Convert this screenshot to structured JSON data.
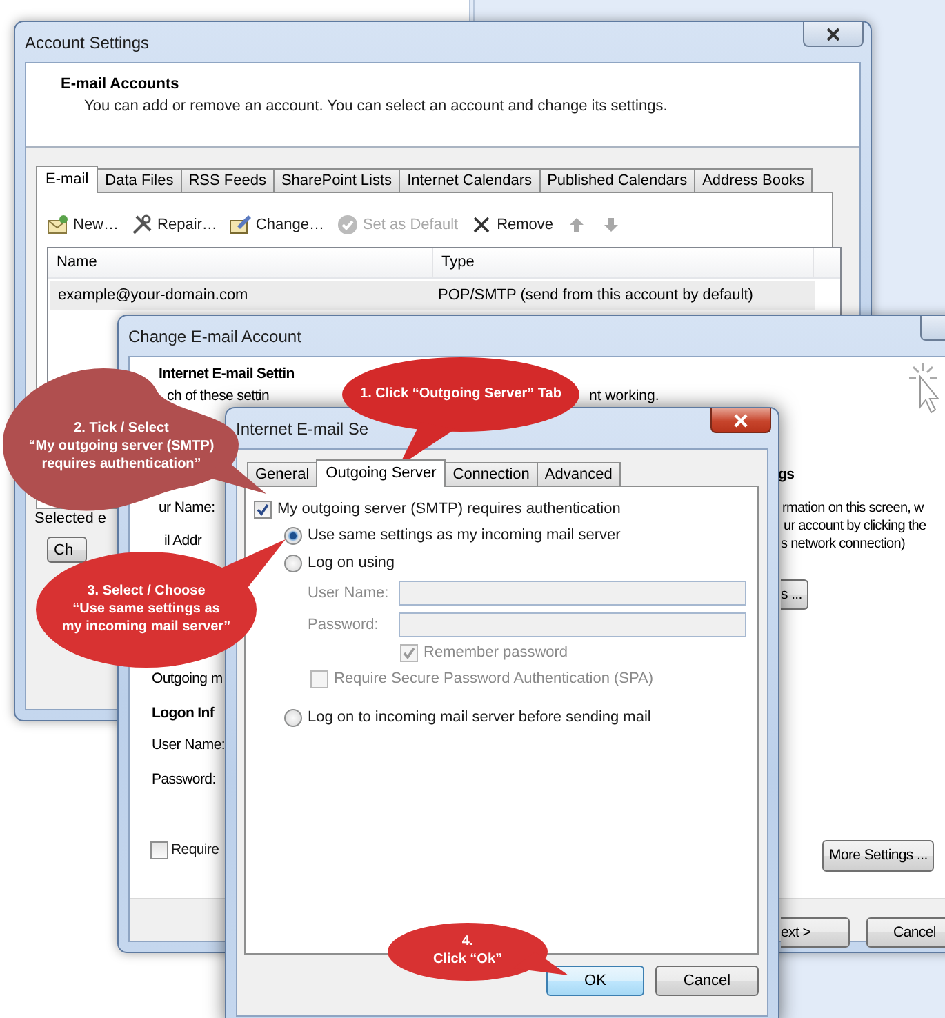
{
  "account_settings": {
    "title": "Account Settings",
    "heading": "E-mail Accounts",
    "subtitle": "You can add or remove an account. You can select an account and change its settings.",
    "tabs": [
      {
        "label": "E-mail",
        "selected": true
      },
      {
        "label": "Data Files",
        "selected": false
      },
      {
        "label": "RSS Feeds",
        "selected": false
      },
      {
        "label": "SharePoint Lists",
        "selected": false
      },
      {
        "label": "Internet Calendars",
        "selected": false
      },
      {
        "label": "Published Calendars",
        "selected": false
      },
      {
        "label": "Address Books",
        "selected": false
      }
    ],
    "toolbar": [
      {
        "kind": "new",
        "label": "New…",
        "disabled": false
      },
      {
        "kind": "repair",
        "label": "Repair…",
        "disabled": false
      },
      {
        "kind": "change",
        "label": "Change…",
        "disabled": false
      },
      {
        "kind": "default",
        "label": "Set as Default",
        "disabled": true
      },
      {
        "kind": "remove",
        "label": "Remove",
        "disabled": false
      },
      {
        "kind": "up",
        "disabled": true
      },
      {
        "kind": "down",
        "disabled": true
      }
    ],
    "table": {
      "columns": [
        "Name",
        "Type"
      ],
      "rows": [
        {
          "cells": [
            "example@your-domain.com",
            "POP/SMTP (send from this account by default)"
          ],
          "selected": true
        }
      ]
    },
    "selected_label": "Selected e",
    "change_button": "Ch"
  },
  "change_account": {
    "title": "Change E-mail Account",
    "heading": "Internet E-mail Settin",
    "intro_left": "ch of these settin",
    "intro_right": "nt working.",
    "left_labels": [
      "ur Name:",
      "il Addr",
      "Outgoing m"
    ],
    "logon_heading": "Logon Inf",
    "logon_labels": [
      "User Name:",
      "Password:"
    ],
    "require_checkbox": {
      "label": "Require",
      "checked": false
    },
    "right_heading": "gs",
    "right_lines": [
      "rmation on this screen, w",
      "ur account by clicking the",
      "s network connection)"
    ],
    "test_button": "s ...",
    "more_settings": "More Settings ...",
    "buttons": [
      "ext >",
      "Cancel"
    ]
  },
  "internet_settings": {
    "title": "Internet E-mail Se",
    "tabs": [
      {
        "label": "General",
        "selected": false
      },
      {
        "label": "Outgoing Server",
        "selected": true
      },
      {
        "label": "Connection",
        "selected": false
      },
      {
        "label": "Advanced",
        "selected": false
      }
    ],
    "auth_checkbox": {
      "label": "My outgoing server (SMTP) requires authentication",
      "checked": true
    },
    "options": [
      {
        "kind": "radio",
        "label": "Use same settings as my incoming mail server",
        "selected": true
      },
      {
        "kind": "radio",
        "label": "Log on using",
        "selected": false
      },
      {
        "kind": "field",
        "label": "User Name:",
        "disabled": true
      },
      {
        "kind": "field",
        "label": "Password:",
        "disabled": true
      },
      {
        "kind": "checkbox",
        "label": "Remember password",
        "checked": true,
        "disabled": true
      },
      {
        "kind": "checkbox",
        "label": "Require Secure Password Authentication (SPA)",
        "checked": false,
        "disabled": true
      },
      {
        "kind": "radio",
        "label": "Log on to incoming mail server before sending mail",
        "selected": false
      }
    ],
    "buttons": [
      "OK",
      "Cancel"
    ]
  },
  "callouts": [
    {
      "lines": [
        "1. Click “Outgoing Server” Tab"
      ],
      "color": "#d42a2a"
    },
    {
      "lines": [
        "2. Tick / Select",
        "“My outgoing server (SMTP)",
        "requires authentication”"
      ],
      "color": "#b04f4f"
    },
    {
      "lines": [
        "3. Select / Choose",
        "“Use same settings as",
        "my incoming mail server”"
      ],
      "color": "#d83232"
    },
    {
      "lines": [
        "4.",
        "Click “Ok”"
      ],
      "color": "#d83232"
    }
  ]
}
